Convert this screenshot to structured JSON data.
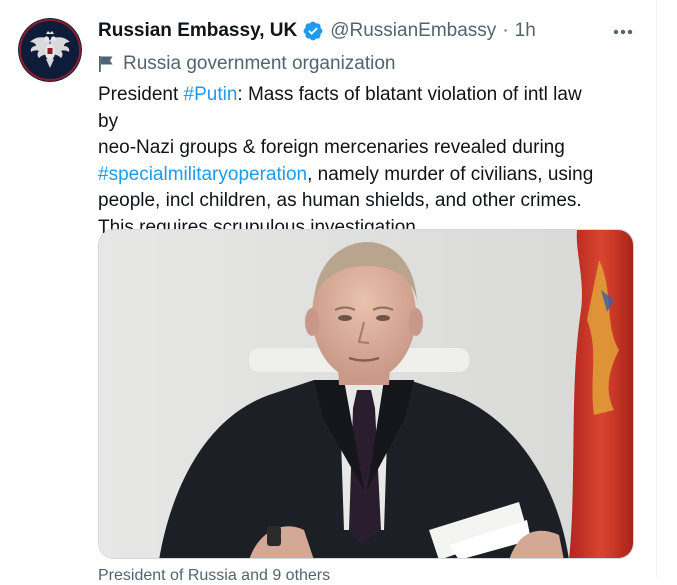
{
  "tweet": {
    "display_name": "Russian Embassy, UK",
    "handle": "@RussianEmbassy",
    "separator": "·",
    "time": "1h",
    "label": "Russia government organization",
    "text": {
      "line1_a": "President ",
      "line1_link": "#Putin",
      "line1_b": ": Mass facts of blatant violation of intl law",
      "line2_a": "by ",
      "line2_b": "neo-Nazi groups & foreign mercenaries revealed during",
      "line3_link": "#specialmilitaryoperation",
      "line3_b": ", namely murder of civilians, using",
      "line4": "people, incl children, as human shields, and other crimes.",
      "line5": "This requires scrupulous investigation."
    },
    "media_caption": "President of Russia and 9 others"
  },
  "icons": {
    "verified": "verified-badge-icon",
    "more": "more-horizontal-icon",
    "label": "flag-icon",
    "emoji": "ukraine-flag-emoji"
  },
  "colors": {
    "link": "#1d9bf0",
    "secondary_text": "#536471",
    "primary_text": "#0f1419",
    "avatar_bg": "#0e1c3a"
  }
}
